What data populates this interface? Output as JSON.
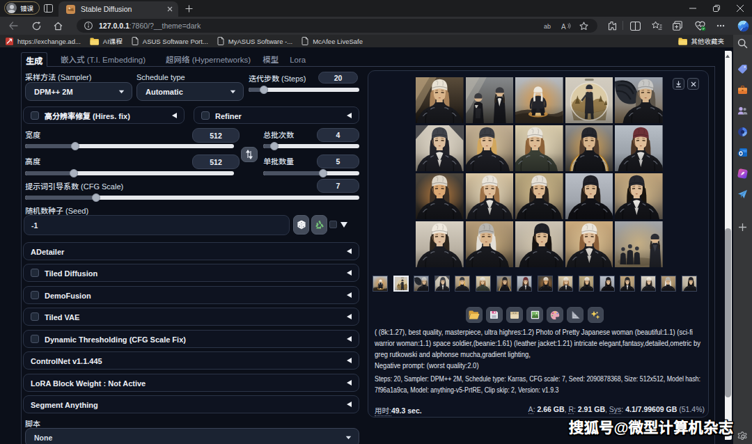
{
  "browser": {
    "profile_label": "错误",
    "tab_title": "Stable Diffusion",
    "url_host": "127.0.0.1",
    "url_rest": ":7860/?__theme=dark",
    "bookmarks": [
      {
        "icon": "exchange",
        "label": "https://exchange.ad..."
      },
      {
        "icon": "folder",
        "label": "AI课程"
      },
      {
        "icon": "page",
        "label": "ASUS Software Port..."
      },
      {
        "icon": "page",
        "label": "MyASUS Software -..."
      },
      {
        "icon": "page",
        "label": "McAfee LiveSafe"
      }
    ],
    "other_favorites": "其他收藏夹",
    "sidebar_icons": [
      "search",
      "tag",
      "briefcase",
      "people",
      "circle-chart",
      "outlook",
      "designer",
      "paper-plane",
      "plus"
    ]
  },
  "app": {
    "tabs": [
      {
        "label": "生成",
        "active": true
      },
      {
        "label": "嵌入式 (T.I. Embedding)",
        "active": false
      },
      {
        "label": "超网络 (Hypernetworks)",
        "active": false
      },
      {
        "label": "模型",
        "active": false
      },
      {
        "label": "Lora",
        "active": false
      }
    ],
    "sampler_label": "采样方法 (Sampler)",
    "sampler_value": "DPM++ 2M",
    "schedule_label": "Schedule type",
    "schedule_value": "Automatic",
    "steps_label": "迭代步数 (Steps)",
    "steps_value": "20",
    "hires_label": "高分辨率修复 (Hires. fix)",
    "refiner_label": "Refiner",
    "width_label": "宽度",
    "width_value": "512",
    "height_label": "高度",
    "height_value": "512",
    "batch_count_label": "总批次数",
    "batch_count_value": "4",
    "batch_size_label": "单批数量",
    "batch_size_value": "5",
    "cfg_label": "提示词引导系数 (CFG Scale)",
    "cfg_value": "7",
    "seed_label": "随机数种子 (Seed)",
    "seed_value": "-1",
    "accordions": [
      {
        "label": "ADetailer",
        "checkbox": false
      },
      {
        "label": "Tiled Diffusion",
        "checkbox": true
      },
      {
        "label": "DemoFusion",
        "checkbox": true
      },
      {
        "label": "Tiled VAE",
        "checkbox": true
      },
      {
        "label": "Dynamic Thresholding (CFG Scale Fix)",
        "checkbox": true
      },
      {
        "label": "ControlNet v1.1.445",
        "checkbox": false
      },
      {
        "label": "LoRA Block Weight : Not Active",
        "checkbox": false
      },
      {
        "label": "Segment Anything",
        "checkbox": false
      }
    ],
    "script_label": "脚本",
    "script_value": "None"
  },
  "output": {
    "toolbar_icons": [
      "open-folder",
      "save",
      "zip",
      "image-frame",
      "palette",
      "ruler",
      "sparkle"
    ],
    "prompt_lines": [
      "( (8k:1.27), best quality, masterpiece, ultra highres:1.2) Photo of Pretty Japanese woman (beautiful:1.1) (sci-fi",
      "warrior woman:1.1) space soldier,(beanie:1.61) (leather jacket:1.21) intricate elegant,fantasy,detailed,ometric by",
      "greg rutkowski and alphonse mucha,gradient lighting,",
      "Negative prompt: (worst quality:2.0)"
    ],
    "params_lines": [
      "Steps: 20, Sampler: DPM++ 2M, Schedule type: Karras, CFG scale: 7, Seed: 2090878368, Size: 512x512, Model hash:",
      "7f96a1a9ca, Model: anything-v5-PrtRE, Clip skip: 2, Version: v1.9.3"
    ],
    "time_label": "用时:",
    "time_value": "49.3 sec.",
    "memory": [
      {
        "label": "A",
        "value": "2.66 GB"
      },
      {
        "label": "R",
        "value": "2.91 GB"
      },
      {
        "label": "Sys",
        "value": "4.1/7.99609 GB"
      }
    ],
    "memory_suffix": "(51.4%)"
  },
  "watermark": "搜狐号@微型计算机杂志",
  "gallery": {
    "cells": [
      {
        "t": "bust",
        "bg": [
          "#5a4c3a",
          "#191511"
        ],
        "beam": "#c3aa83",
        "glow": "",
        "beanie": "#e9e2d4",
        "hair": "#a8825a",
        "jacket": "#1b1c21",
        "shirt": "",
        "skin": "#dbb68c",
        "fx": 0
      },
      {
        "t": "two",
        "bg": [
          "#85888b",
          "#46443f"
        ],
        "beam": "#b9b5ac",
        "glow": "",
        "beanie": "#3a3b40",
        "hair": "#2c2620",
        "jacket": "#17181d",
        "shirt": "#d8d7d2",
        "skin": "#d9b68e",
        "fx": 0
      },
      {
        "t": "full",
        "bg": [
          "#b7bbc1",
          "#8d8269"
        ],
        "beam": "",
        "glow": "#e09a45",
        "beanie": "#ece7dd",
        "hair": "#e6e1d6",
        "jacket": "#23242a",
        "shirt": "",
        "skin": "#dcc0a0",
        "fx": 0
      },
      {
        "t": "sphere",
        "bg": [
          "#d2ccc0",
          "#c2bbad"
        ],
        "beam": "",
        "glow": "",
        "beanie": "#2a2c33",
        "hair": "#23252b",
        "jacket": "#23252b",
        "shirt": "",
        "skin": "#d9b68e",
        "fx": 0
      },
      {
        "t": "bust",
        "bg": [
          "#9aa2ae",
          "#7d6a50"
        ],
        "beam": "",
        "glow": "",
        "beanie": "#c7c7c5",
        "hair": "#5d554a",
        "jacket": "#191a1f",
        "shirt": "",
        "skin": "#d6b48c",
        "fx": 10,
        "wing": 1
      },
      {
        "t": "bust",
        "bg": [
          "#d3ccbf",
          "#9d9586"
        ],
        "beam": "",
        "glow": "#e5ddcd",
        "beanie": "#40434a",
        "hair": "#23242a",
        "jacket": "#202128",
        "shirt": "#e4e1da",
        "skin": "#dcbf9e",
        "fx": 0,
        "corners": 1
      },
      {
        "t": "bust",
        "bg": [
          "#c3b094",
          "#6e6250"
        ],
        "beam": "",
        "glow": "#d8c49e",
        "beanie": "#3b3d43",
        "hair": "#d2a75d",
        "jacket": "#1d1e24",
        "shirt": "",
        "skin": "#e0bd96",
        "fx": -4
      },
      {
        "t": "bust",
        "bg": [
          "#d8cbab",
          "#8c8270"
        ],
        "beam": "",
        "glow": "#e8dcbd",
        "beanie": "#e8e3d8",
        "hair": "#8c6239",
        "jacket": "#3a3f35",
        "shirt": "",
        "skin": "#ddbb93",
        "fx": -6
      },
      {
        "t": "bust",
        "bg": [
          "#8f8e8c",
          "#4e4a43"
        ],
        "beam": "",
        "glow": "#e2a74e",
        "beanie": "#24252b",
        "hair": "#523d2c",
        "jacket": "#17181d",
        "shirt": "",
        "skin": "#d8b58c",
        "fx": 0,
        "arc": 1,
        "slim": 1
      },
      {
        "t": "bust",
        "bg": [
          "#b8bfc7",
          "#899098"
        ],
        "beam": "",
        "glow": "",
        "beanie": "#6d3036",
        "hair": "#4b3526",
        "jacket": "#1a1b20",
        "shirt": "#dbdad6",
        "skin": "#dfbd99",
        "fx": 3
      },
      {
        "t": "bust",
        "bg": [
          "#4c463d",
          "#26211c"
        ],
        "beam": "",
        "glow": "#cd8740",
        "beanie": "#ded6c8",
        "hair": "#3b2f24",
        "jacket": "#16171c",
        "shirt": "",
        "skin": "#dba873",
        "fx": 0
      },
      {
        "t": "bust",
        "bg": [
          "#d9c6a4",
          "#706553"
        ],
        "beam": "",
        "glow": "#ecdfc2",
        "beanie": "#eae4d9",
        "hair": "#9c7147",
        "jacket": "#1c1d23",
        "shirt": "#e5e2db",
        "skin": "#dfbd98",
        "fx": 0
      },
      {
        "t": "bust",
        "bg": [
          "#bba87e",
          "#6b5f4d"
        ],
        "beam": "",
        "glow": "#dbc491",
        "beanie": "#e7e1d6",
        "hair": "#2f2720",
        "jacket": "#15161a",
        "shirt": "",
        "skin": "#ddb88f",
        "fx": 0
      },
      {
        "t": "bust",
        "bg": [
          "#babfc7",
          "#8f949c"
        ],
        "beam": "",
        "glow": "",
        "beanie": "#202128",
        "hair": "#251e18",
        "jacket": "#111116",
        "shirt": "",
        "skin": "#dcba94",
        "fx": 2
      },
      {
        "t": "bust",
        "bg": [
          "#c2a67c",
          "#6e665b"
        ],
        "beam": "",
        "glow": "#d9bd8a",
        "beanie": "#27282e",
        "hair": "#18140f",
        "jacket": "#15161b",
        "shirt": "#e8e6e1",
        "skin": "#debd99",
        "fx": -3
      },
      {
        "t": "bust",
        "bg": [
          "#d7d0c3",
          "#a79e8f"
        ],
        "beam": "",
        "glow": "",
        "beanie": "#efe9de",
        "hair": "#2d251d",
        "jacket": "#1b1c22",
        "shirt": "",
        "skin": "#dfc0a0",
        "fx": 0
      },
      {
        "t": "bust",
        "bg": [
          "#b69d7a",
          "#60533f"
        ],
        "beam": "",
        "glow": "#c9ad7e",
        "beanie": "#b9b6b0",
        "hair": "#e3dfd6",
        "jacket": "#191a1f",
        "shirt": "",
        "skin": "#d9b58c",
        "fx": -5
      },
      {
        "t": "bust",
        "bg": [
          "#cdc4b5",
          "#978d7c"
        ],
        "beam": "",
        "glow": "#d8ccb4",
        "beanie": "#212228",
        "hair": "#171310",
        "jacket": "#17181d",
        "shirt": "",
        "skin": "#dcba93",
        "fx": 4
      },
      {
        "t": "bust",
        "bg": [
          "#cbaa7d",
          "#8e7b5e"
        ],
        "beam": "",
        "glow": "#e4c897",
        "beanie": "#ece6db",
        "hair": "#8a5f3a",
        "jacket": "#1b1c21",
        "shirt": "#dcd7cf",
        "skin": "#e0bf9b",
        "fx": 0
      },
      {
        "t": "group",
        "bg": [
          "#a2a5aa",
          "#8d7c5e"
        ],
        "beam": "",
        "glow": "#c9b184",
        "beanie": "#2c2d33",
        "hair": "#20201f",
        "jacket": "#23252c",
        "shirt": "",
        "skin": "#d9b68e",
        "fx": 0
      }
    ],
    "thumb_map": [
      2,
      3,
      4,
      5,
      6,
      7,
      8,
      9,
      10,
      11,
      12,
      13,
      14,
      15,
      16,
      17
    ],
    "selected_thumb": 1
  }
}
